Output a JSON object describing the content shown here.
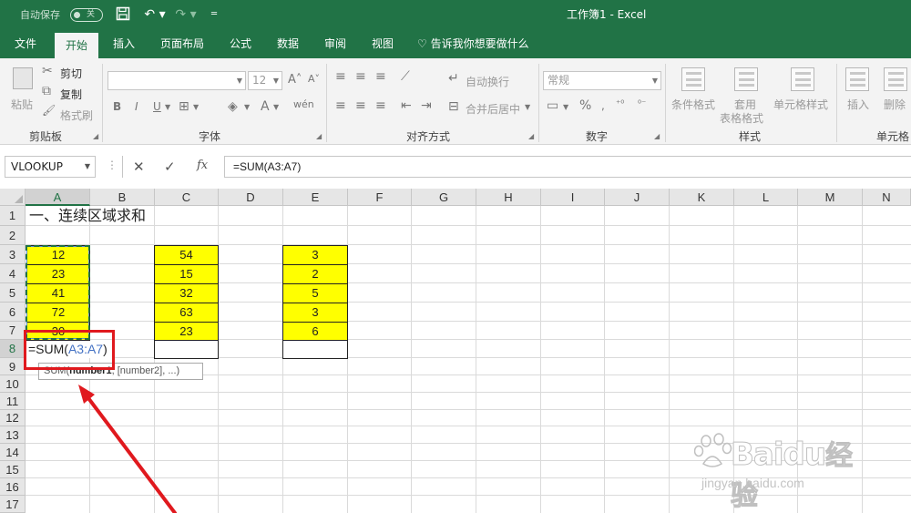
{
  "titlebar": {
    "autosave_label": "自动保存",
    "autosave_state": "关",
    "doc_title": "工作簿1  -   Excel"
  },
  "tabs": [
    {
      "label": "文件",
      "active": false
    },
    {
      "label": "开始",
      "active": true
    },
    {
      "label": "插入",
      "active": false
    },
    {
      "label": "页面布局",
      "active": false
    },
    {
      "label": "公式",
      "active": false
    },
    {
      "label": "数据",
      "active": false
    },
    {
      "label": "审阅",
      "active": false
    },
    {
      "label": "视图",
      "active": false
    }
  ],
  "tell_me": "告诉我你想要做什么",
  "ribbon": {
    "clipboard": {
      "paste": "粘贴",
      "cut": "剪切",
      "copy": "复制",
      "format_painter": "格式刷",
      "label": "剪贴板"
    },
    "font": {
      "name": "",
      "size": "12",
      "bold": "B",
      "italic": "I",
      "underline": "U",
      "label": "字体"
    },
    "alignment": {
      "wrap": "自动换行",
      "merge": "合并后居中",
      "label": "对齐方式"
    },
    "number": {
      "format": "常规",
      "percent": "%",
      "label": "数字"
    },
    "styles": {
      "conditional": "条件格式",
      "table_1": "套用",
      "table_2": "表格格式",
      "cell_styles": "单元格样式",
      "label": "样式"
    },
    "cells": {
      "insert": "插入",
      "delete": "删除",
      "label": "单元格"
    }
  },
  "formula_bar": {
    "name_box": "VLOOKUP",
    "cancel": "✕",
    "enter": "✓",
    "fx": "fx",
    "formula": "=SUM(A3:A7)"
  },
  "grid": {
    "columns": [
      "A",
      "B",
      "C",
      "D",
      "E",
      "F",
      "G",
      "H",
      "I",
      "J",
      "K",
      "L",
      "M",
      "N"
    ],
    "rows": [
      "1",
      "2",
      "3",
      "4",
      "5",
      "6",
      "7",
      "8",
      "9",
      "10",
      "11",
      "12",
      "13",
      "14",
      "15",
      "16",
      "17"
    ],
    "title_cell": "一、连续区域求和",
    "col_a": [
      "12",
      "23",
      "41",
      "72",
      "30"
    ],
    "col_c": [
      "54",
      "15",
      "32",
      "63",
      "23"
    ],
    "col_e": [
      "3",
      "2",
      "5",
      "3",
      "6"
    ],
    "edit_prefix": "=SUM(",
    "edit_ref": "A3:A7",
    "edit_suffix": ")",
    "tooltip_fn": "SUM(",
    "tooltip_arg1": "number1",
    "tooltip_rest": ", [number2], ...)"
  },
  "watermark": {
    "brand": "Baidu",
    "brand_cn": "经验",
    "url": "jingyan.baidu.com"
  },
  "colors": {
    "excel_green": "#217346",
    "highlight_yellow": "#ffff00",
    "annotation_red": "#e0191e"
  }
}
